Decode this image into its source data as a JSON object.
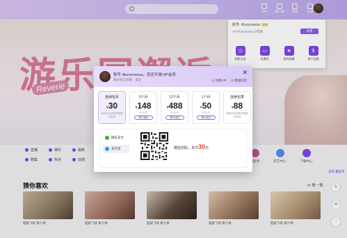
{
  "topbar": {
    "icons": [
      {
        "label": "VIP",
        "icon": "vip-icon"
      },
      {
        "label": "客户端",
        "icon": "client-icon"
      },
      {
        "label": "消息",
        "icon": "message-icon"
      },
      {
        "label": "记录",
        "icon": "history-icon"
      }
    ]
  },
  "banner": {
    "title": "游乐园邂逅",
    "subtitle": "Reverie"
  },
  "user_panel": {
    "account_label": "账号: lilisoumeess",
    "vip_tag": "VIP",
    "expire": "VIP于2018-06-12到期",
    "renew_label": "续费",
    "features": [
      {
        "label": "观影记录",
        "icon": "history-icon"
      },
      {
        "label": "优惠券",
        "icon": "coupon-icon"
      },
      {
        "label": "我的收藏",
        "icon": "star-icon"
      },
      {
        "label": "账户金额",
        "icon": "wallet-icon"
      }
    ]
  },
  "categories": {
    "rows": [
      [
        "直播",
        "娱乐",
        "最新"
      ],
      [
        "剧集",
        "热点",
        "动漫"
      ]
    ],
    "right": [
      "观影券",
      "综艺中心",
      "下载中心"
    ]
  },
  "side_label": "签到 赢金币",
  "guess": {
    "title": "猜你喜欢",
    "swap_label": "换一换",
    "items": [
      {
        "caption": "超级飞侠 第六季",
        "color": "#8a7a62"
      },
      {
        "caption": "超级飞侠 第六季",
        "color": "#9a6c5e"
      },
      {
        "caption": "超级飞侠 第六季",
        "color": "#5f4b3d"
      },
      {
        "caption": "超级飞侠 第六季",
        "color": "#a07e64"
      },
      {
        "caption": "超级飞侠 第六季",
        "color": "#b69a7a"
      }
    ]
  },
  "modal": {
    "user_line": "账号 lilisoumeess，您还不是VIP会员",
    "level_line": "账号安全等级：安全",
    "links": [
      "兑换VIP",
      "赠送好友"
    ],
    "plans": [
      {
        "name": "连续包月",
        "currency": "¥",
        "price": "30",
        "original": "",
        "desc": "每月自动续费享受随时取消",
        "selected": true,
        "select_label": ""
      },
      {
        "name": "3个月",
        "currency": "¥",
        "price": "148",
        "original": "45元/月",
        "desc": "",
        "selected": false,
        "select_label": "周卡续约"
      },
      {
        "name": "12个月",
        "currency": "¥",
        "price": "488",
        "original": "40元/月",
        "desc": "",
        "selected": false,
        "select_label": "周卡续约"
      },
      {
        "name": "1个月",
        "currency": "¥",
        "price": "50",
        "original": "50元/月",
        "desc": "",
        "selected": false,
        "select_label": "周卡续约"
      },
      {
        "name": "连续包季",
        "currency": "¥",
        "price": "88",
        "original": "",
        "desc": "每季自动续费享受随时取消",
        "selected": false,
        "select_label": ""
      }
    ],
    "pay_methods": [
      {
        "label": "微信支付",
        "active": false
      },
      {
        "label": "支付宝",
        "active": true
      }
    ],
    "pay_prefix": "微信扫码，支付",
    "pay_amount": "30",
    "pay_unit": "元"
  }
}
